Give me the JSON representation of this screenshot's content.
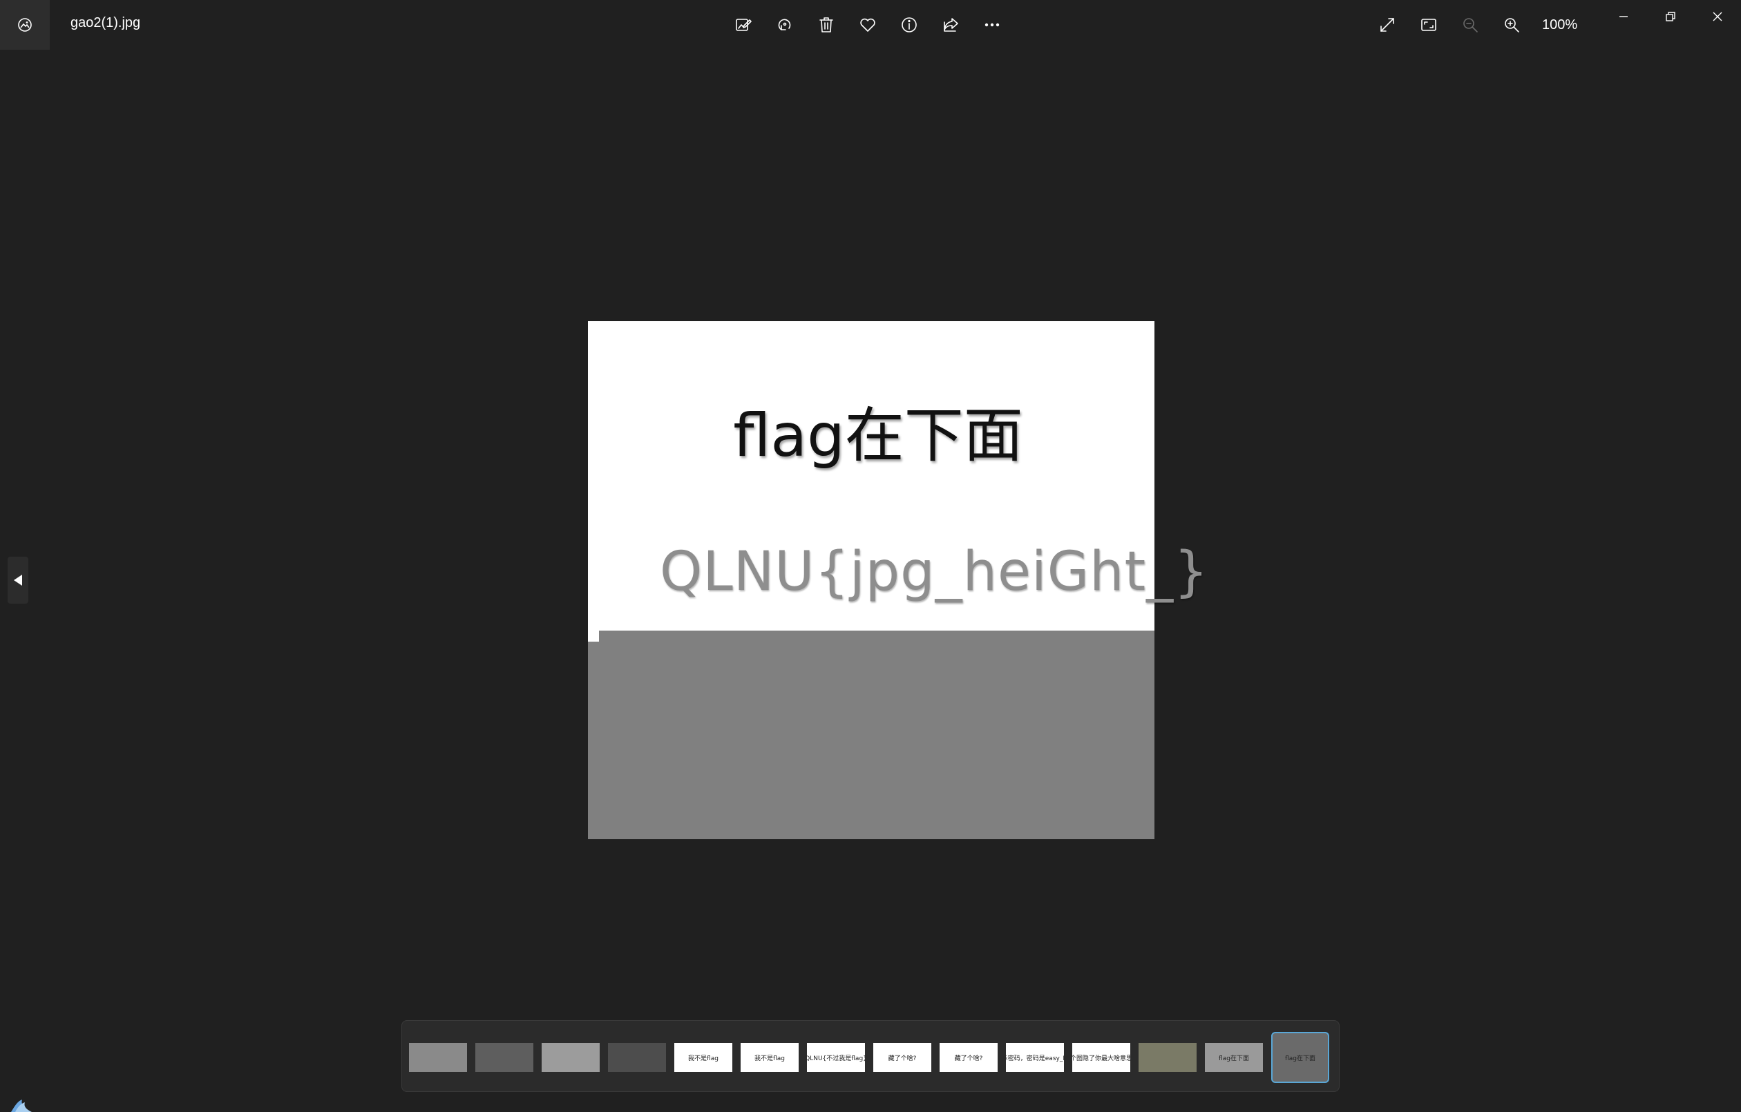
{
  "window": {
    "filename": "gao2(1).jpg",
    "zoom_level": "100%"
  },
  "toolbar": {
    "buttons": [
      {
        "name": "edit-image",
        "icon": "edit-image-icon"
      },
      {
        "name": "rotate",
        "icon": "rotate-icon"
      },
      {
        "name": "delete",
        "icon": "trash-icon"
      },
      {
        "name": "favorite",
        "icon": "heart-icon"
      },
      {
        "name": "file-info",
        "icon": "info-icon"
      },
      {
        "name": "share",
        "icon": "share-icon"
      },
      {
        "name": "more",
        "icon": "more-icon"
      }
    ],
    "right": [
      {
        "name": "full-screen",
        "icon": "expand-icon"
      },
      {
        "name": "fit-to-window",
        "icon": "fit-window-icon"
      },
      {
        "name": "zoom-out",
        "icon": "zoom-out-icon",
        "disabled": true
      },
      {
        "name": "zoom-in",
        "icon": "zoom-in-icon"
      }
    ]
  },
  "image": {
    "headline": "flag在下面",
    "flag_text": "QLNU{jpg_heiGht_}"
  },
  "filmstrip": {
    "thumbnails": [
      {
        "label": "",
        "bg": "#8a8a8a"
      },
      {
        "label": "",
        "bg": "#5e5e5e"
      },
      {
        "label": "",
        "bg": "#9c9c9c"
      },
      {
        "label": "",
        "bg": "#4d4d4d"
      },
      {
        "label": "我不是flag",
        "bg": "#ffffff"
      },
      {
        "label": "我不是flag",
        "bg": "#ffffff"
      },
      {
        "label": "QLNU{不过我是flag}",
        "bg": "#ffffff"
      },
      {
        "label": "藏了个啥?",
        "bg": "#ffffff"
      },
      {
        "label": "藏了个啥?",
        "bg": "#ffffff"
      },
      {
        "label": "提示密码，密码是easy_LSB",
        "bg": "#ffffff"
      },
      {
        "label": "这个图隐了你最大啥意思了",
        "bg": "#ffffff"
      },
      {
        "label": "",
        "bg": "#7a7a66"
      },
      {
        "label": "flag在下面",
        "bg": "#9a9a9a"
      },
      {
        "label": "flag在下面",
        "bg": "#6a6a6a"
      }
    ],
    "selected_index": 13
  }
}
